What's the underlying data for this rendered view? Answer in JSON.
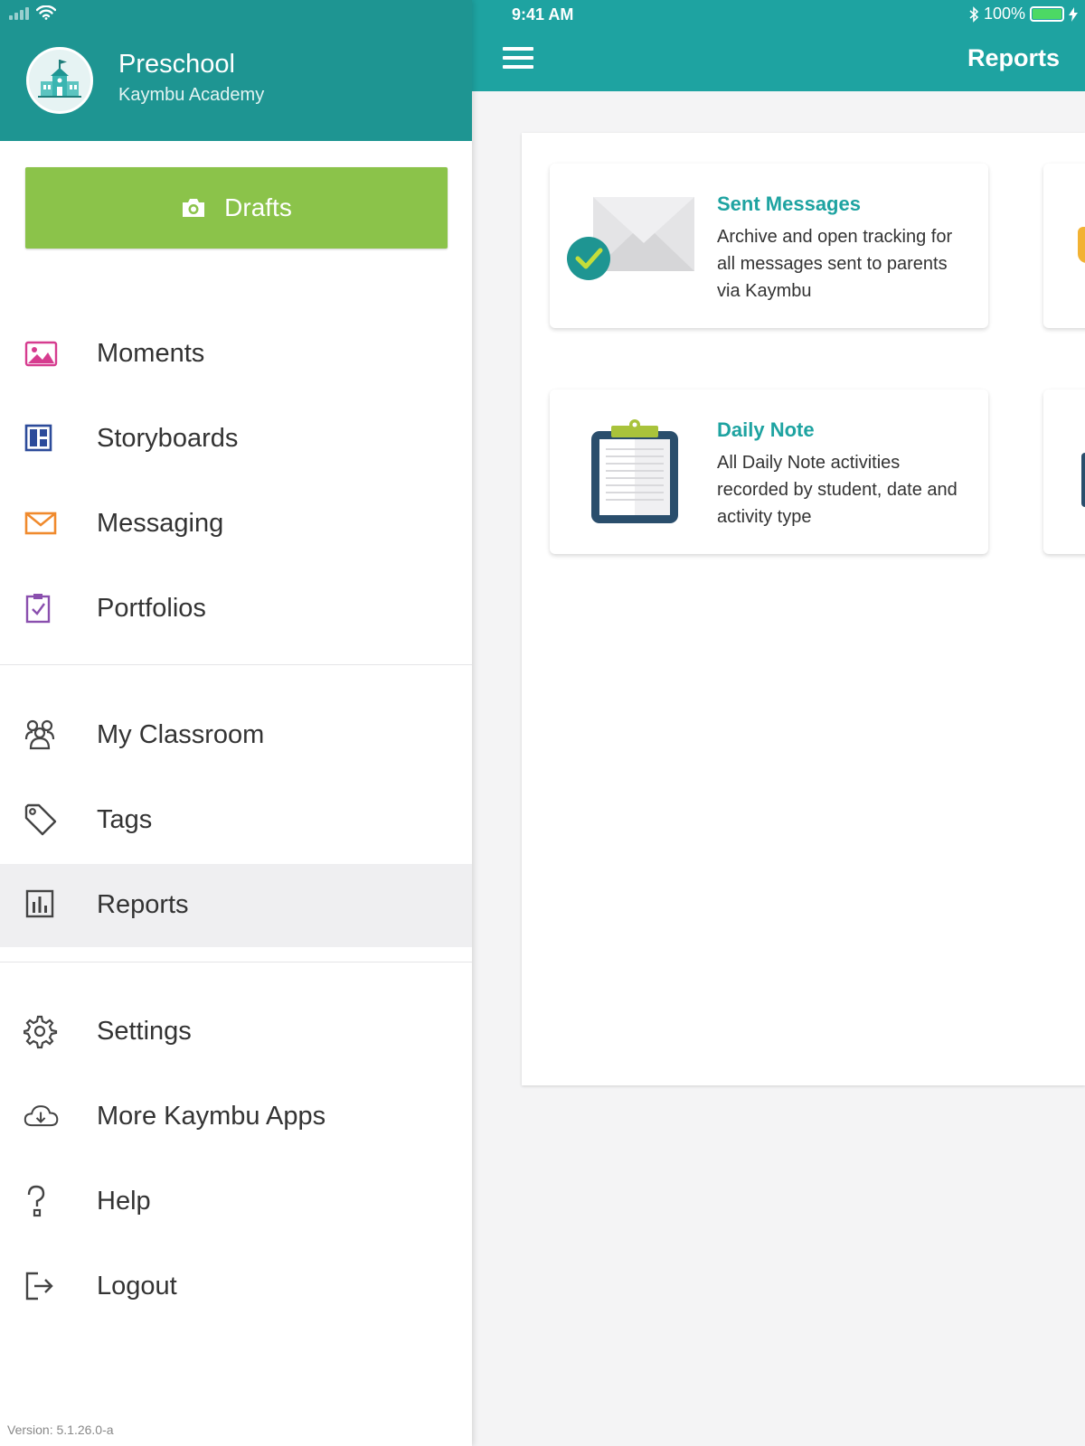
{
  "status_bar": {
    "time": "9:41 AM",
    "battery": "100%"
  },
  "drawer": {
    "school_name": "Preschool",
    "school_subtitle": "Kaymbu Academy",
    "drafts_label": "Drafts",
    "menu_groups": [
      [
        {
          "id": "moments",
          "label": "Moments",
          "icon": "image-icon",
          "color": "#d63c8f"
        },
        {
          "id": "storyboards",
          "label": "Storyboards",
          "icon": "layout-icon",
          "color": "#2c4b9a"
        },
        {
          "id": "messaging",
          "label": "Messaging",
          "icon": "envelope-icon",
          "color": "#f08a2d"
        },
        {
          "id": "portfolios",
          "label": "Portfolios",
          "icon": "clipboard-check-icon",
          "color": "#8a4fae"
        }
      ],
      [
        {
          "id": "my-classroom",
          "label": "My Classroom",
          "icon": "people-icon",
          "color": "#444444"
        },
        {
          "id": "tags",
          "label": "Tags",
          "icon": "tag-icon",
          "color": "#444444"
        },
        {
          "id": "reports",
          "label": "Reports",
          "icon": "bar-chart-icon",
          "color": "#444444",
          "active": true
        }
      ],
      [
        {
          "id": "settings",
          "label": "Settings",
          "icon": "gear-icon",
          "color": "#444444"
        },
        {
          "id": "more-apps",
          "label": "More Kaymbu Apps",
          "icon": "cloud-download-icon",
          "color": "#444444"
        },
        {
          "id": "help",
          "label": "Help",
          "icon": "question-icon",
          "color": "#444444"
        },
        {
          "id": "logout",
          "label": "Logout",
          "icon": "logout-icon",
          "color": "#444444"
        }
      ]
    ],
    "version": "Version: 5.1.26.0-a"
  },
  "header": {
    "title": "Reports"
  },
  "reports": [
    {
      "id": "sent-messages",
      "title": "Sent Messages",
      "description": "Archive and open tracking for all messages sent to parents via Kaymbu",
      "icon": "envelope-check-icon"
    },
    {
      "id": "daily-note",
      "title": "Daily Note",
      "description": "All Daily Note activities recorded by student, date and activity type",
      "icon": "clipboard-icon"
    }
  ],
  "colors": {
    "header_teal": "#1ea3a1",
    "drawer_teal": "#1e9592",
    "drafts_green": "#8bc34a",
    "accent_text": "#1ea3a1"
  }
}
